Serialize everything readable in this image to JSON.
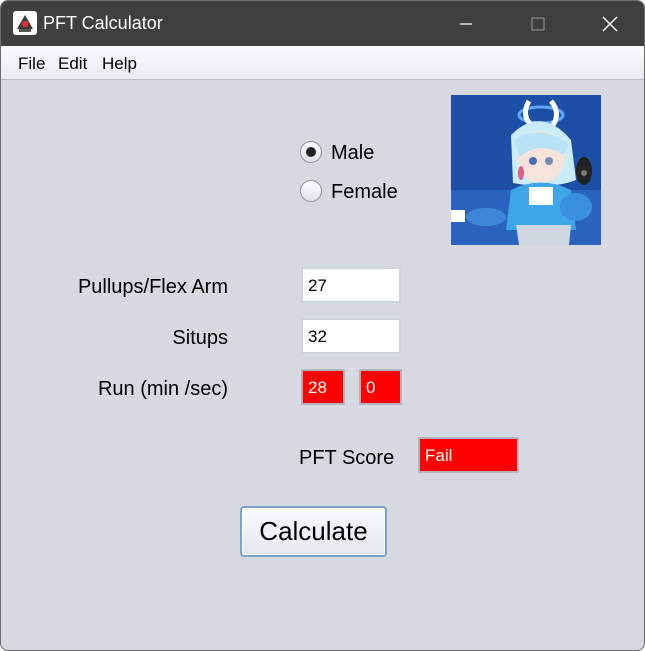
{
  "window": {
    "title": "PFT Calculator",
    "icon": "java-duke-icon"
  },
  "menu": {
    "items": [
      "File",
      "Edit",
      "Help"
    ]
  },
  "gender": {
    "options": [
      "Male",
      "Female"
    ],
    "selected": "Male"
  },
  "avatar": {
    "description": "anime-character-image"
  },
  "form": {
    "pullups_label": "Pullups/Flex Arm",
    "pullups_value": "27",
    "situps_label": "Situps",
    "situps_value": "32",
    "run_label": "Run (min /sec)",
    "run_min": "28",
    "run_sec": "0"
  },
  "result": {
    "label": "PFT Score",
    "value": "Fail"
  },
  "actions": {
    "calculate_label": "Calculate"
  },
  "colors": {
    "titlebar": "#3f3f3f",
    "panel": "#d6d9e0",
    "error_field": "#ff0000",
    "button_border": "#7aa3cc"
  }
}
